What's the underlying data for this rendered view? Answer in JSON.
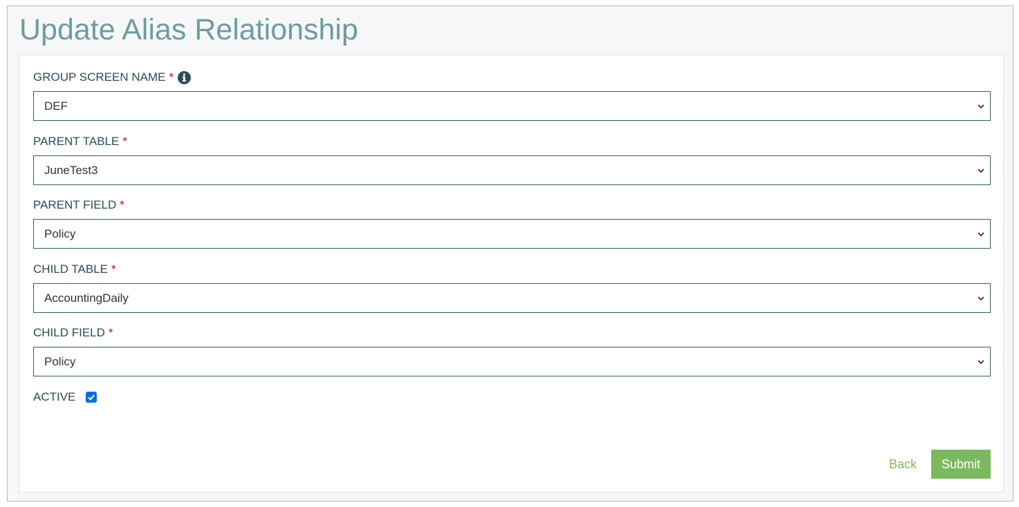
{
  "page": {
    "title": "Update Alias Relationship"
  },
  "form": {
    "group_screen_name": {
      "label": "GROUP SCREEN NAME",
      "required_mark": "*",
      "value": "DEF"
    },
    "parent_table": {
      "label": "PARENT TABLE",
      "required_mark": "*",
      "value": "JuneTest3"
    },
    "parent_field": {
      "label": "PARENT FIELD",
      "required_mark": "*",
      "value": "Policy"
    },
    "child_table": {
      "label": "CHILD TABLE",
      "required_mark": "*",
      "value": "AccountingDaily"
    },
    "child_field": {
      "label": "CHILD FIELD",
      "required_mark": "*",
      "value": "Policy"
    },
    "active": {
      "label": "ACTIVE",
      "checked": true
    }
  },
  "actions": {
    "back_label": "Back",
    "submit_label": "Submit"
  },
  "colors": {
    "title": "#6b9da1",
    "accent_green": "#7cb85f",
    "required": "#d0021b",
    "checkbox": "#0b6fd6"
  },
  "icons": {
    "info": "info-circle-icon",
    "chevron": "chevron-down-icon",
    "check": "checkmark-icon"
  }
}
